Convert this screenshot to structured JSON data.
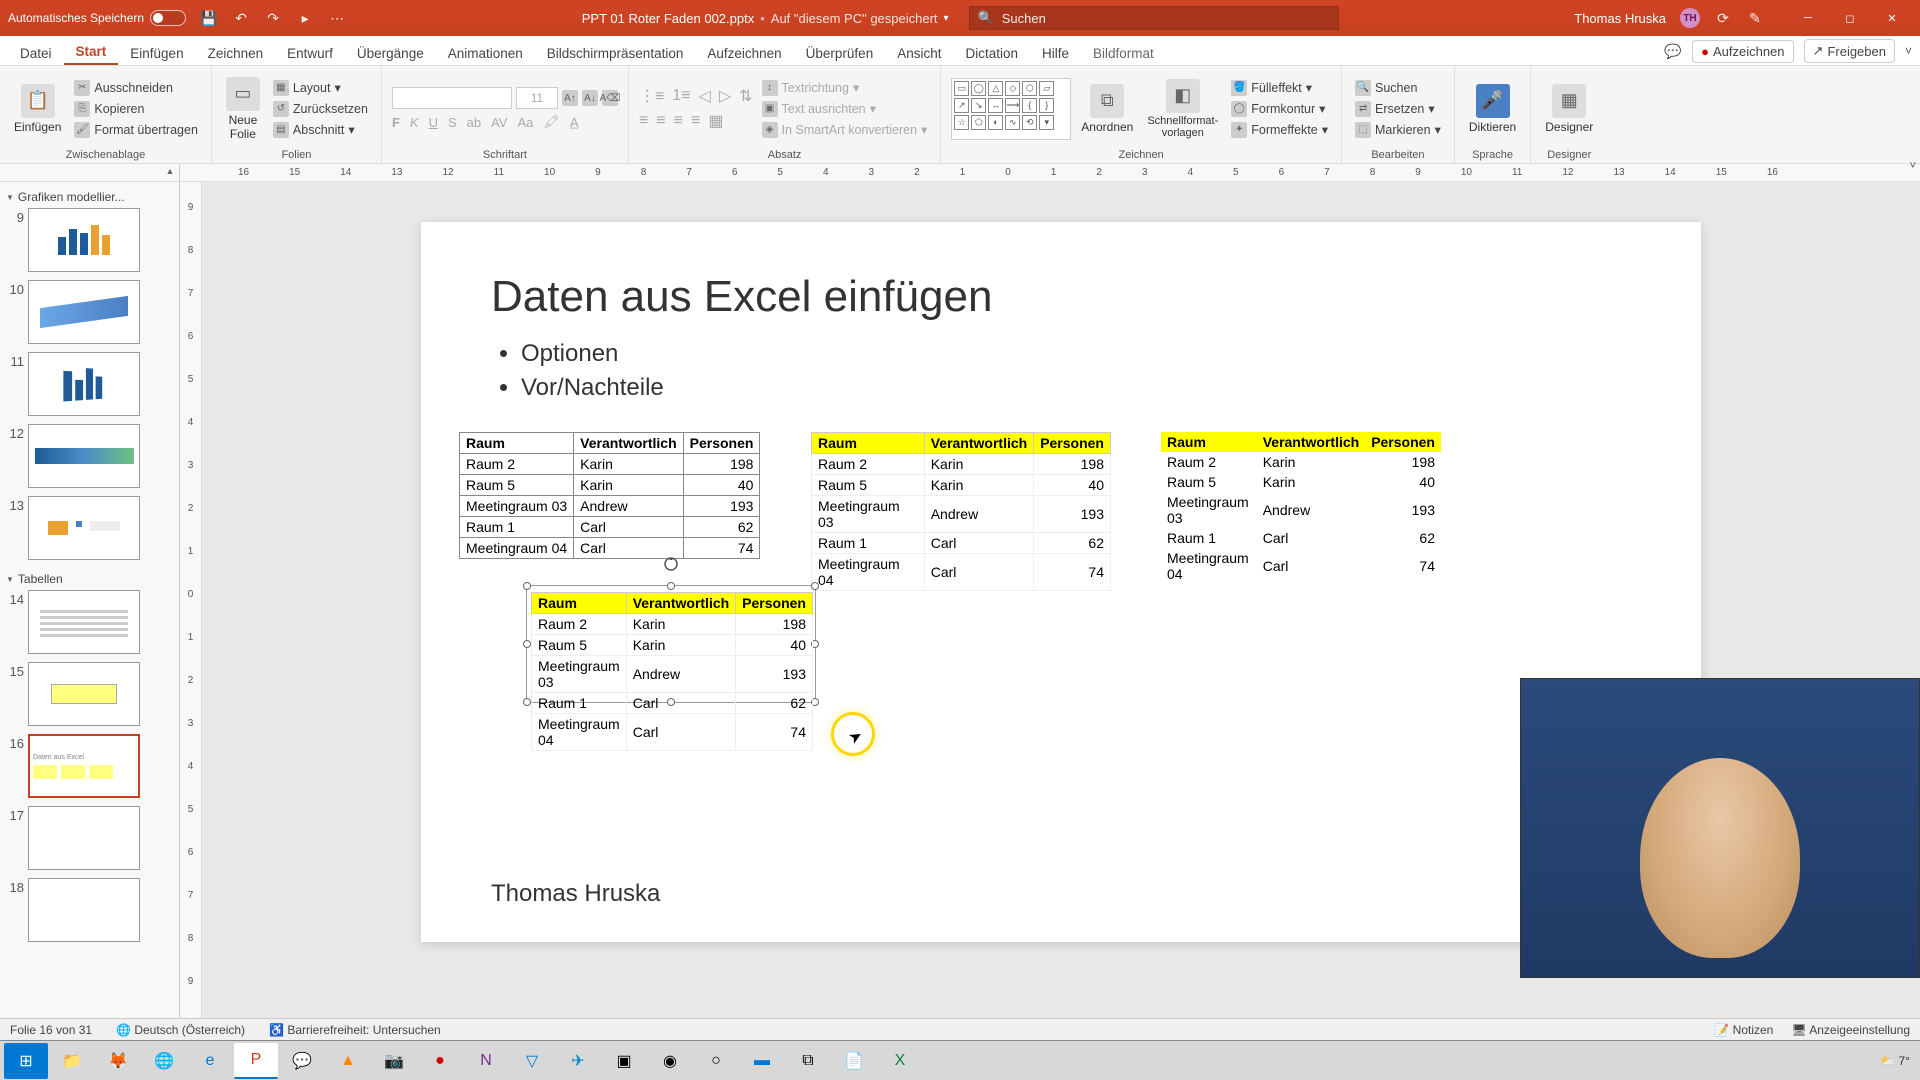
{
  "titlebar": {
    "autosave": "Automatisches Speichern",
    "doc_name": "PPT 01 Roter Faden 002.pptx",
    "save_location": "Auf \"diesem PC\" gespeichert",
    "search_placeholder": "Suchen",
    "user_name": "Thomas Hruska",
    "user_initials": "TH"
  },
  "tabs": {
    "items": [
      "Datei",
      "Start",
      "Einfügen",
      "Zeichnen",
      "Entwurf",
      "Übergänge",
      "Animationen",
      "Bildschirmpräsentation",
      "Aufzeichnen",
      "Überprüfen",
      "Ansicht",
      "Dictation",
      "Hilfe",
      "Bildformat"
    ],
    "active": "Start",
    "record": "Aufzeichnen",
    "share": "Freigeben"
  },
  "ribbon": {
    "clipboard": {
      "label": "Zwischenablage",
      "paste": "Einfügen",
      "cut": "Ausschneiden",
      "copy": "Kopieren",
      "format": "Format übertragen"
    },
    "slides": {
      "label": "Folien",
      "new": "Neue\nFolie",
      "layout": "Layout",
      "reset": "Zurücksetzen",
      "section": "Abschnitt"
    },
    "font": {
      "label": "Schriftart",
      "size": "11"
    },
    "paragraph": {
      "label": "Absatz",
      "textdir": "Textrichtung",
      "align": "Text ausrichten",
      "smartart": "In SmartArt konvertieren"
    },
    "drawing": {
      "label": "Zeichnen",
      "arrange": "Anordnen",
      "quickstyle": "Schnellformat-\nvorlagen",
      "fill": "Fülleffekt",
      "outline": "Formkontur",
      "effects": "Formeffekte"
    },
    "editing": {
      "label": "Bearbeiten",
      "find": "Suchen",
      "replace": "Ersetzen",
      "select": "Markieren"
    },
    "voice": {
      "label": "Sprache",
      "dictate": "Diktieren"
    },
    "designer": {
      "label": "Designer",
      "btn": "Designer"
    }
  },
  "sections": {
    "s1": "Grafiken modellier...",
    "s2": "Tabellen"
  },
  "thumbs": [
    "9",
    "10",
    "11",
    "12",
    "13",
    "14",
    "15",
    "16",
    "17",
    "18"
  ],
  "slide": {
    "title": "Daten aus Excel einfügen",
    "b1": "Optionen",
    "b2": "Vor/Nachteile",
    "author": "Thomas Hruska"
  },
  "table": {
    "h1": "Raum",
    "h2": "Verantwortlich",
    "h3": "Personen",
    "rows": [
      {
        "r": "Raum 2",
        "v": "Karin",
        "p": "198"
      },
      {
        "r": "Raum 5",
        "v": "Karin",
        "p": "40"
      },
      {
        "r": "Meetingraum 03",
        "v": "Andrew",
        "p": "193"
      },
      {
        "r": "Raum 1",
        "v": "Carl",
        "p": "62"
      },
      {
        "r": "Meetingraum 04",
        "v": "Carl",
        "p": "74"
      }
    ]
  },
  "status": {
    "slide_count": "Folie 16 von 31",
    "lang": "Deutsch (Österreich)",
    "access": "Barrierefreiheit: Untersuchen",
    "notes": "Notizen",
    "display": "Anzeigeeinstellung"
  },
  "taskbar": {
    "temp": "7°"
  },
  "ruler": {
    "hvals": [
      "16",
      "15",
      "14",
      "13",
      "12",
      "11",
      "10",
      "9",
      "8",
      "7",
      "6",
      "5",
      "4",
      "3",
      "2",
      "1",
      "0",
      "1",
      "2",
      "3",
      "4",
      "5",
      "6",
      "7",
      "8",
      "9",
      "10",
      "11",
      "12",
      "13",
      "14",
      "15",
      "16"
    ],
    "vvals": [
      "9",
      "8",
      "7",
      "6",
      "5",
      "4",
      "3",
      "2",
      "1",
      "0",
      "1",
      "2",
      "3",
      "4",
      "5",
      "6",
      "7",
      "8",
      "9"
    ]
  }
}
